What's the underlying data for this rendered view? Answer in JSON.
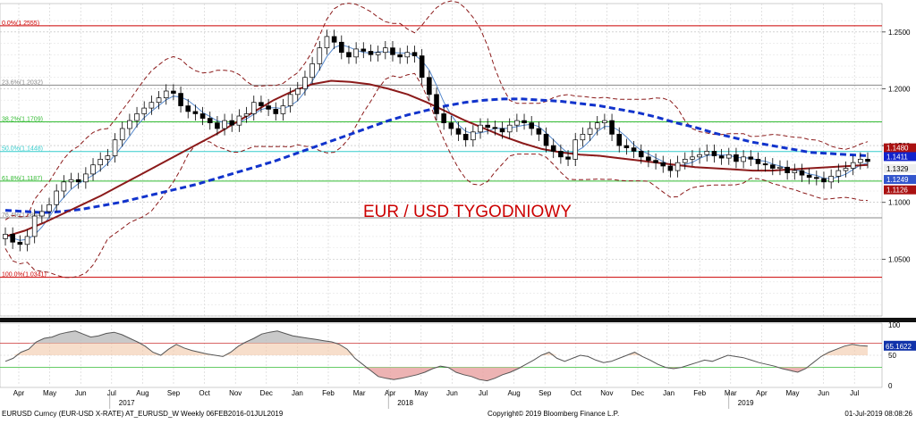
{
  "chart_data": {
    "type": "candlestick",
    "title": "EUR / USD TYGODNIOWY",
    "title_color": "#cc0000",
    "ylim": [
      1.0,
      1.275
    ],
    "y_ticks": [
      "1.0500",
      "1.1000",
      "1.1500",
      "1.2000",
      "1.2500"
    ],
    "y_tick_values": [
      1.05,
      1.1,
      1.15,
      1.2,
      1.25
    ],
    "grid": true,
    "month_labels": [
      "Apr",
      "May",
      "Jun",
      "Jul",
      "Aug",
      "Sep",
      "Oct",
      "Nov",
      "Dec",
      "Jan",
      "Feb",
      "Mar",
      "Apr",
      "May",
      "Jun",
      "Jul",
      "Aug",
      "Sep",
      "Oct",
      "Nov",
      "Dec",
      "Jan",
      "Feb",
      "Mar",
      "Apr",
      "May",
      "Jun",
      "Jul"
    ],
    "year_labels": [
      {
        "label": "2017",
        "after_month_index": 3
      },
      {
        "label": "2018",
        "after_month_index": 12
      },
      {
        "label": "2019",
        "after_month_index": 23
      }
    ],
    "fib_levels": [
      {
        "label": "0.0%(1.2555)",
        "value": 1.2555,
        "color": "#cc0000"
      },
      {
        "label": "23.6%(1.2032)",
        "value": 1.2032,
        "color": "#888888"
      },
      {
        "label": "38.2%(1.1709)",
        "value": 1.1709,
        "color": "#33bb33"
      },
      {
        "label": "50.0%(1.1448)",
        "value": 1.1448,
        "color": "#33cccc"
      },
      {
        "label": "61.8%(1.1187)",
        "value": 1.1187,
        "color": "#33bb33"
      },
      {
        "label": "76.4%(1.0864)",
        "value": 1.0864,
        "color": "#888888"
      },
      {
        "label": "100.0%(1.0341)",
        "value": 1.0341,
        "color": "#cc0000"
      }
    ],
    "price_tags": [
      {
        "label": "1.1480",
        "value": 1.148,
        "bg": "#aa1111",
        "fg": "#ffffff"
      },
      {
        "label": "1.1411",
        "value": 1.1411,
        "bg": "#1122cc",
        "fg": "#ffffff"
      },
      {
        "label": "1.1329",
        "value": 1.1329,
        "bg": "#eeeeee",
        "fg": "#000000"
      },
      {
        "label": "1.1249",
        "value": 1.1249,
        "bg": "#3355cc",
        "fg": "#ffffff"
      },
      {
        "label": "1.1126",
        "value": 1.1126,
        "bg": "#aa1111",
        "fg": "#ffffff"
      }
    ],
    "weekly_closes": [
      1.072,
      1.065,
      1.063,
      1.07,
      1.088,
      1.092,
      1.098,
      1.11,
      1.118,
      1.12,
      1.118,
      1.125,
      1.133,
      1.138,
      1.141,
      1.155,
      1.165,
      1.172,
      1.178,
      1.183,
      1.188,
      1.192,
      1.198,
      1.196,
      1.185,
      1.18,
      1.178,
      1.174,
      1.17,
      1.165,
      1.172,
      1.168,
      1.176,
      1.178,
      1.188,
      1.185,
      1.182,
      1.178,
      1.185,
      1.195,
      1.2,
      1.21,
      1.222,
      1.236,
      1.246,
      1.241,
      1.232,
      1.228,
      1.235,
      1.233,
      1.23,
      1.232,
      1.236,
      1.23,
      1.228,
      1.232,
      1.229,
      1.21,
      1.195,
      1.178,
      1.17,
      1.165,
      1.16,
      1.155,
      1.162,
      1.168,
      1.166,
      1.165,
      1.162,
      1.168,
      1.172,
      1.17,
      1.165,
      1.16,
      1.15,
      1.145,
      1.14,
      1.138,
      1.155,
      1.16,
      1.165,
      1.17,
      1.172,
      1.16,
      1.15,
      1.148,
      1.145,
      1.14,
      1.137,
      1.135,
      1.132,
      1.128,
      1.135,
      1.138,
      1.14,
      1.142,
      1.145,
      1.141,
      1.139,
      1.142,
      1.136,
      1.14,
      1.138,
      1.134,
      1.133,
      1.13,
      1.131,
      1.126,
      1.128,
      1.124,
      1.122,
      1.121,
      1.118,
      1.123,
      1.128,
      1.13,
      1.135,
      1.138,
      1.136
    ],
    "moving_averages": [
      {
        "name": "",
        "color": "#1133cc",
        "style": "dashed",
        "values": [
          1.093,
          1.092,
          1.091,
          1.092,
          1.094,
          1.097,
          1.1,
          1.104,
          1.108,
          1.112,
          1.116,
          1.121,
          1.126,
          1.131,
          1.136,
          1.142,
          1.148,
          1.154,
          1.16,
          1.166,
          1.172,
          1.177,
          1.181,
          1.185,
          1.188,
          1.19,
          1.191,
          1.191,
          1.19,
          1.189,
          1.187,
          1.185,
          1.182,
          1.179,
          1.175,
          1.17,
          1.166,
          1.161,
          1.157,
          1.153,
          1.15,
          1.147,
          1.144,
          1.143,
          1.142,
          1.141
        ]
      },
      {
        "name": "",
        "color": "#8b1a1a",
        "style": "solid",
        "values": [
          1.07,
          1.075,
          1.082,
          1.09,
          1.098,
          1.106,
          1.115,
          1.124,
          1.133,
          1.142,
          1.151,
          1.16,
          1.17,
          1.18,
          1.19,
          1.198,
          1.204,
          1.207,
          1.206,
          1.204,
          1.2,
          1.195,
          1.188,
          1.18,
          1.172,
          1.165,
          1.158,
          1.152,
          1.147,
          1.144,
          1.142,
          1.141,
          1.139,
          1.137,
          1.135,
          1.133,
          1.131,
          1.13,
          1.129,
          1.128,
          1.128,
          1.129,
          1.13,
          1.131,
          1.132,
          1.133
        ]
      }
    ],
    "rsi": {
      "value_label": "65.1622",
      "ylim": [
        0,
        100
      ],
      "ticks": [
        "100",
        "50",
        "0"
      ],
      "overbought": 70,
      "oversold": 30,
      "values": [
        40,
        45,
        55,
        60,
        72,
        78,
        80,
        85,
        88,
        90,
        85,
        80,
        82,
        86,
        88,
        84,
        78,
        72,
        65,
        55,
        50,
        60,
        68,
        62,
        58,
        55,
        52,
        50,
        48,
        55,
        65,
        72,
        78,
        85,
        88,
        90,
        86,
        82,
        80,
        78,
        76,
        74,
        72,
        68,
        60,
        45,
        35,
        25,
        15,
        12,
        10,
        12,
        15,
        18,
        22,
        28,
        32,
        30,
        22,
        18,
        15,
        10,
        8,
        12,
        18,
        22,
        28,
        35,
        42,
        50,
        55,
        45,
        40,
        45,
        50,
        48,
        42,
        38,
        40,
        45,
        50,
        55,
        48,
        42,
        35,
        30,
        28,
        30,
        34,
        38,
        42,
        40,
        45,
        50,
        48,
        46,
        42,
        38,
        35,
        32,
        28,
        25,
        22,
        28,
        38,
        48,
        55,
        60,
        65,
        68,
        66,
        65
      ]
    }
  },
  "footer": {
    "left": "EURUSD Curncy (EUR-USD X-RATE) AT_EURUSD_W Weekly 06FEB2016-01JUL2019",
    "center": "Copyright© 2019 Bloomberg Finance L.P.",
    "right": "01-Jul-2019 08:08:26"
  }
}
